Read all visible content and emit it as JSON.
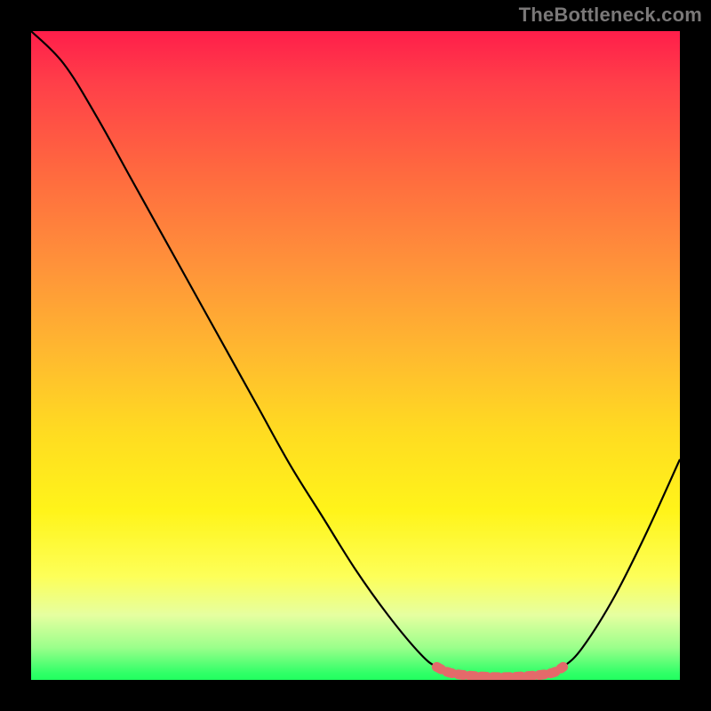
{
  "watermark": "TheBottleneck.com",
  "chart_data": {
    "type": "line",
    "title": "",
    "xlabel": "",
    "ylabel": "",
    "xlim": [
      0,
      1
    ],
    "ylim": [
      0,
      1
    ],
    "series": [
      {
        "name": "black-curve",
        "x": [
          0.0,
          0.05,
          0.1,
          0.15,
          0.2,
          0.25,
          0.3,
          0.35,
          0.4,
          0.45,
          0.5,
          0.55,
          0.6,
          0.625,
          0.65,
          0.7,
          0.75,
          0.8,
          0.82,
          0.85,
          0.9,
          0.95,
          1.0
        ],
        "y": [
          1.0,
          0.95,
          0.87,
          0.78,
          0.69,
          0.6,
          0.51,
          0.42,
          0.33,
          0.25,
          0.17,
          0.1,
          0.04,
          0.02,
          0.01,
          0.005,
          0.005,
          0.01,
          0.02,
          0.05,
          0.13,
          0.23,
          0.34
        ]
      },
      {
        "name": "red-accent-segment",
        "x": [
          0.625,
          0.65,
          0.7,
          0.75,
          0.8,
          0.82
        ],
        "y": [
          0.02,
          0.01,
          0.005,
          0.005,
          0.01,
          0.02
        ]
      }
    ],
    "gradient_stops": [
      {
        "pos": 0.0,
        "color": "#ff1e4a"
      },
      {
        "pos": 0.5,
        "color": "#ffba2f"
      },
      {
        "pos": 0.8,
        "color": "#fdff58"
      },
      {
        "pos": 1.0,
        "color": "#21ff60"
      }
    ]
  }
}
